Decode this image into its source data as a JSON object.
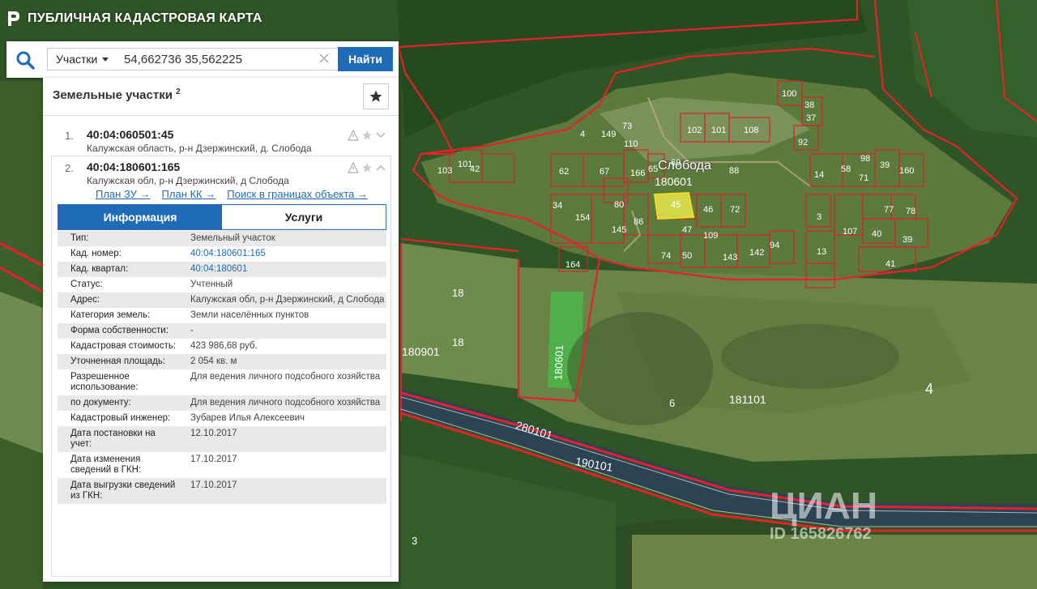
{
  "header": {
    "title": "ПУБЛИЧНАЯ КАДАСТРОВАЯ КАРТА"
  },
  "search": {
    "type_label": "Участки",
    "value": "54,662736 35,562225",
    "button_label": "Найти"
  },
  "results": {
    "title": "Земельные участки",
    "count": "2",
    "items": [
      {
        "num": "1.",
        "id": "40:04:060501:45",
        "address": "Калужская область, р-н Дзержинский, д. Слобода"
      },
      {
        "num": "2.",
        "id": "40:04:180601:165",
        "address": "Калужская обл, р-н Дзержинский, д Слобода"
      }
    ],
    "links": [
      "План ЗУ →",
      "План КК →",
      "Поиск в границах объекта →"
    ],
    "tabs": [
      "Информация",
      "Услуги"
    ],
    "info": [
      {
        "k": "Тип:",
        "v": "Земельный участок"
      },
      {
        "k": "Кад. номер:",
        "v": "40:04:180601:165"
      },
      {
        "k": "Кад. квартал:",
        "v": "40:04:180601"
      },
      {
        "k": "Статус:",
        "v": "Учтенный"
      },
      {
        "k": "Адрес:",
        "v": "Калужская обл, р-н Дзержинский, д Слобода"
      },
      {
        "k": "Категория земель:",
        "v": "Земли населённых пунктов"
      },
      {
        "k": "Форма собственности:",
        "v": "-"
      },
      {
        "k": "Кадастровая стоимость:",
        "v": "423 986,68 руб."
      },
      {
        "k": "Уточненная площадь:",
        "v": "2 054 кв. м"
      },
      {
        "k": "Разрешенное использование:",
        "v": "Для ведения личного подсобного хозяйства"
      },
      {
        "k": "по документу:",
        "v": "Для ведения личного подсобного хозяйства"
      },
      {
        "k": "Кадастровый инженер:",
        "v": "Зубарев Илья Алексеевич"
      },
      {
        "k": "Дата постановки на учет:",
        "v": "12.10.2017"
      },
      {
        "k": "Дата изменения сведений в ГКН:",
        "v": "17.10.2017"
      },
      {
        "k": "Дата выгрузки сведений из ГКН:",
        "v": "17.10.2017"
      }
    ]
  },
  "map": {
    "village_name": "Слобода",
    "quarter_labels": [
      "180601",
      "180901",
      "181101",
      "280101",
      "190101"
    ],
    "parcel_labels": [
      "4",
      "149",
      "73",
      "102",
      "101",
      "108",
      "100",
      "38",
      "37",
      "110",
      "92",
      "103",
      "101",
      "42",
      "62",
      "67",
      "166",
      "65",
      "69",
      "88",
      "14",
      "58",
      "71",
      "98",
      "39",
      "160",
      "34",
      "154",
      "80",
      "86",
      "45",
      "46",
      "72",
      "3",
      "77",
      "78",
      "40",
      "39",
      "145",
      "47",
      "109",
      "143",
      "142",
      "94",
      "107",
      "13",
      "41",
      "74",
      "50",
      "164",
      "18",
      "18",
      "6",
      "4",
      "3"
    ],
    "watermark": "ЦИАН",
    "watermark_id": "ID 165826762"
  },
  "colors": {
    "accent": "#1f6bb5",
    "boundary": "#e8202a"
  }
}
